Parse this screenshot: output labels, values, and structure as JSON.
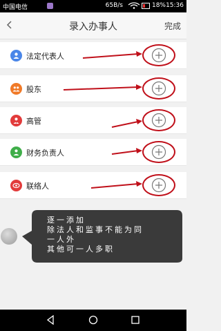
{
  "status_bar": {
    "carrier": "中国电信",
    "net_speed": "65B/s",
    "battery": "18%",
    "time": "15:36"
  },
  "nav": {
    "title": "录入办事人",
    "done_label": "完成"
  },
  "rows": [
    {
      "label": "法定代表人",
      "icon": "person-icon",
      "color": "#4a86e8"
    },
    {
      "label": "股东",
      "icon": "group-icon",
      "color": "#f07a28"
    },
    {
      "label": "高管",
      "icon": "manager-icon",
      "color": "#e23b3b"
    },
    {
      "label": "财务负责人",
      "icon": "finance-person-icon",
      "color": "#3fae49"
    },
    {
      "label": "联络人",
      "icon": "contact-icon",
      "color": "#e23b3b"
    }
  ],
  "tip": {
    "line1": "逐一添加",
    "line2": "除法人和监事不能为同",
    "line3": "一人外",
    "line4": "其他可一人多职"
  },
  "colors": {
    "annotation_red": "#c0101a",
    "bubble": "#3a3a3a"
  }
}
